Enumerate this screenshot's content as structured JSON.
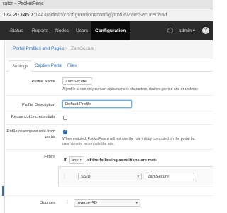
{
  "browser": {
    "title": "rator - PacketFenc",
    "url_host": "172.20.145.7",
    "url_path": ":1443/admin/configuration#config/profile/ZamSecure/read"
  },
  "navbar": {
    "items": [
      {
        "label": "Status"
      },
      {
        "label": "Reports"
      },
      {
        "label": "Nodes"
      },
      {
        "label": "Users"
      },
      {
        "label": "Configuration"
      }
    ],
    "user": "admin",
    "help": "?"
  },
  "breadcrumb": {
    "parent": "Portal Profiles and Pages",
    "separator": ">",
    "current": "ZamSecure"
  },
  "tabs": [
    {
      "label": "Settings"
    },
    {
      "label": "Captive Portal"
    },
    {
      "label": "Files"
    }
  ],
  "form": {
    "profile_name": {
      "label": "Profile Name",
      "value": "ZamSecure",
      "help": "A profile id can only contain alphanumeric characters, dashes, period and or undersc"
    },
    "profile_description": {
      "label": "Profile Description",
      "value": "Default Profile"
    },
    "reuse_dot1x": {
      "label": "Reuse dot1x credentials",
      "checked": false
    },
    "dot1x_recompute": {
      "label_line1": "Dot1x recompute role from",
      "label_line2": "portal",
      "checked": true,
      "help_line1": "When enabled, PacketFence will not use the role initialy computed on the portal bu",
      "help_line2": "username to recompute the role."
    },
    "filters": {
      "label": "Filters",
      "if_text": "If",
      "match_value": "any",
      "suffix": "of the following conditions are met:",
      "rule": {
        "type": "SSID",
        "value": "ZamSecure"
      }
    },
    "sources": {
      "label": "Sources",
      "value": "Inverse-AD"
    }
  },
  "colors": {
    "link": "#2a72c7",
    "navbar": "#2b2b2b"
  }
}
